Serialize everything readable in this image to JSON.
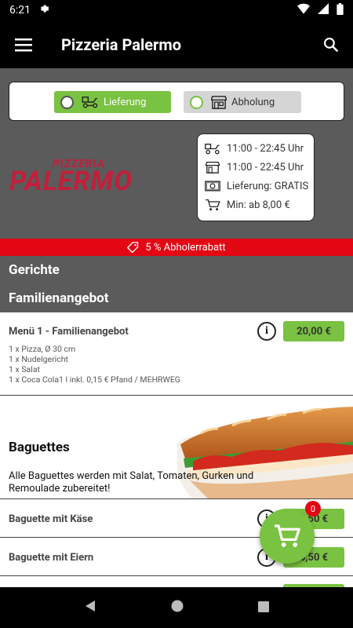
{
  "status_bar": {
    "time": "6:21"
  },
  "app_bar": {
    "title": "Pizzeria Palermo"
  },
  "mode_toggle": {
    "delivery_label": "Lieferung",
    "pickup_label": "Abholung",
    "selected": "delivery"
  },
  "logo": {
    "top_text": "PIZZERIA",
    "main_text": "PALERMO"
  },
  "info": {
    "delivery_hours": "11:00 - 22:45 Uhr",
    "pickup_hours": "11:00 - 22:45 Uhr",
    "delivery_fee": "Lieferung: GRATIS",
    "min_order": "Min: ab 8,00 €"
  },
  "discount_banner": "5 % Abholerrabatt",
  "sections": {
    "dishes": "Gerichte",
    "family": "Familienangebot"
  },
  "family_item": {
    "name": "Menü 1 - Familienangebot",
    "price": "20,00 €",
    "desc": [
      "1 x Pizza, Ø 30 cm",
      "1 x Nudelgericht",
      "1 x Salat",
      "1 x Coca Cola1 l inkl. 0,15 € Pfand / MEHRWEG"
    ]
  },
  "baguettes": {
    "title": "Baguettes",
    "text": "Alle Baguettes werden mit Salat, Tomaten, Gurken und Remoulade zubereitet!",
    "items": [
      {
        "name": "Baguette mit Käse",
        "price": "5,50 €"
      },
      {
        "name": "Baguette mit Eiern",
        "price": "5,50 €"
      }
    ]
  },
  "cart": {
    "count": "0"
  },
  "colors": {
    "accent_green": "#7ac241",
    "brand_red": "#c41e3a",
    "banner_red": "#e30613",
    "header_gray": "#5b5b5b"
  }
}
